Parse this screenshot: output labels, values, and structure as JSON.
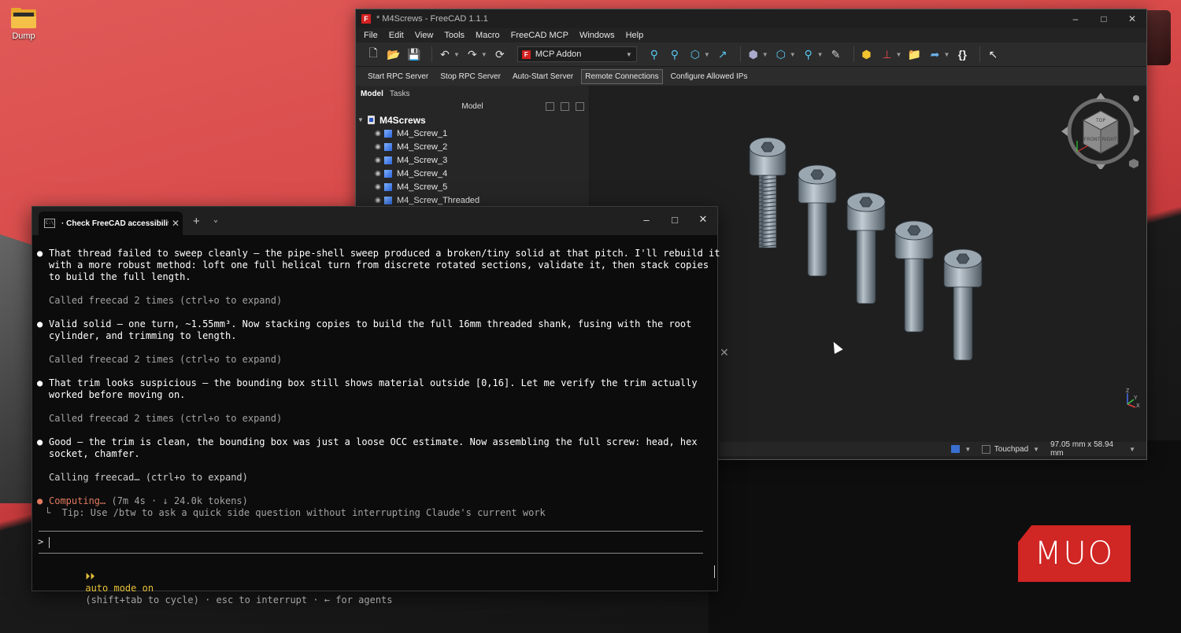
{
  "desktop": {
    "icon_label": "Dump"
  },
  "freecad": {
    "title": "* M4Screws - FreeCAD 1.1.1",
    "menu": [
      "File",
      "Edit",
      "View",
      "Tools",
      "Macro",
      "FreeCAD MCP",
      "Windows",
      "Help"
    ],
    "workbench": "MCP Addon",
    "rpc_buttons": [
      "Start RPC Server",
      "Stop RPC Server",
      "Auto-Start Server",
      "Remote Connections",
      "Configure Allowed IPs"
    ],
    "combo_tabs": [
      "Model",
      "Tasks"
    ],
    "panel_title": "Model",
    "tree_root": "M4Screws",
    "tree_items": [
      "M4_Screw_1",
      "M4_Screw_2",
      "M4_Screw_3",
      "M4_Screw_4",
      "M4_Screw_5",
      "M4_Screw_Threaded"
    ],
    "navcube_faces": {
      "top": "TOP",
      "front": "FRONT",
      "right": "RIGHT"
    },
    "axes": {
      "z": "Z",
      "y": "Y",
      "x": "X"
    },
    "status": {
      "nav_style": "Touchpad",
      "dimensions": "97.05 mm x 58.94 mm"
    }
  },
  "terminal": {
    "tab_title": "· Check FreeCAD accessibility",
    "lines": {
      "p1a": "That thread failed to sweep cleanly — the pipe-shell sweep produced a broken/tiny solid at that pitch. I'll rebuild it",
      "p1b": "with a more robust method: loft one full helical turn from discrete rotated sections, validate it, then stack copies",
      "p1c": "to build the full length.",
      "c1": "Called freecad 2 times (ctrl+o to expand)",
      "p2a": "Valid solid — one turn, ~1.55mm³. Now stacking copies to build the full 16mm threaded shank, fusing with the root",
      "p2b": "cylinder, and trimming to length.",
      "c2": "Called freecad 2 times (ctrl+o to expand)",
      "p3a": "That trim looks suspicious — the bounding box still shows material outside [0,16]. Let me verify the trim actually",
      "p3b": "worked before moving on.",
      "c3": "Called freecad 2 times (ctrl+o to expand)",
      "p4a": "Good — the trim is clean, the bounding box was just a loose OCC estimate. Now assembling the full screw: head, hex",
      "p4b": "socket, chamfer.",
      "c4": "Calling freecad… (ctrl+o to expand)",
      "computing": "Computing…",
      "computing_meta": "(7m 4s · ↓ 24.0k tokens)",
      "tip": "└  Tip: Use /btw to ask a quick side question without interrupting Claude's current work"
    },
    "prompt": "> ",
    "mode_arrows": "⏵⏵",
    "mode_label": "auto mode on",
    "mode_rest": "(shift+tab to cycle) · esc to interrupt · ← for agents"
  },
  "watermark": "MUO"
}
